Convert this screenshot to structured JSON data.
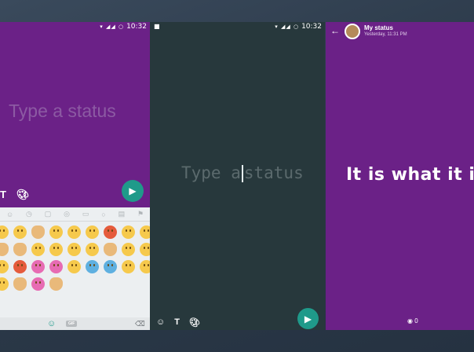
{
  "phone1": {
    "status_bar": {
      "time": "10:32",
      "signal": "▾ ◢◢ ○"
    },
    "placeholder": "Type a status",
    "tools": {
      "text_label": "T",
      "palette_icon": "palette-icon"
    },
    "send_icon": "send-icon",
    "keyboard": {
      "tab_icons": [
        "emoji-icon",
        "recent-icon",
        "animals-icon",
        "sports-icon",
        "car-icon",
        "bulb-icon",
        "symbols-icon",
        "flag-icon"
      ],
      "gif_label": "GIF"
    }
  },
  "phone2": {
    "status_bar": {
      "time": "10:32",
      "signal": "▾ ◢◢ ○"
    },
    "placeholder_part1": "Type a",
    "placeholder_part2": "status",
    "tools": {
      "text_label": "T"
    },
    "send_icon": "send-icon"
  },
  "phone3": {
    "header": {
      "name": "My status",
      "time": "Yesterday, 11:31 PM"
    },
    "status_text": "It is what it is",
    "views": "0"
  },
  "colors": {
    "purple": "#6b2187",
    "dark": "#27383c",
    "teal": "#1f9a8a"
  }
}
